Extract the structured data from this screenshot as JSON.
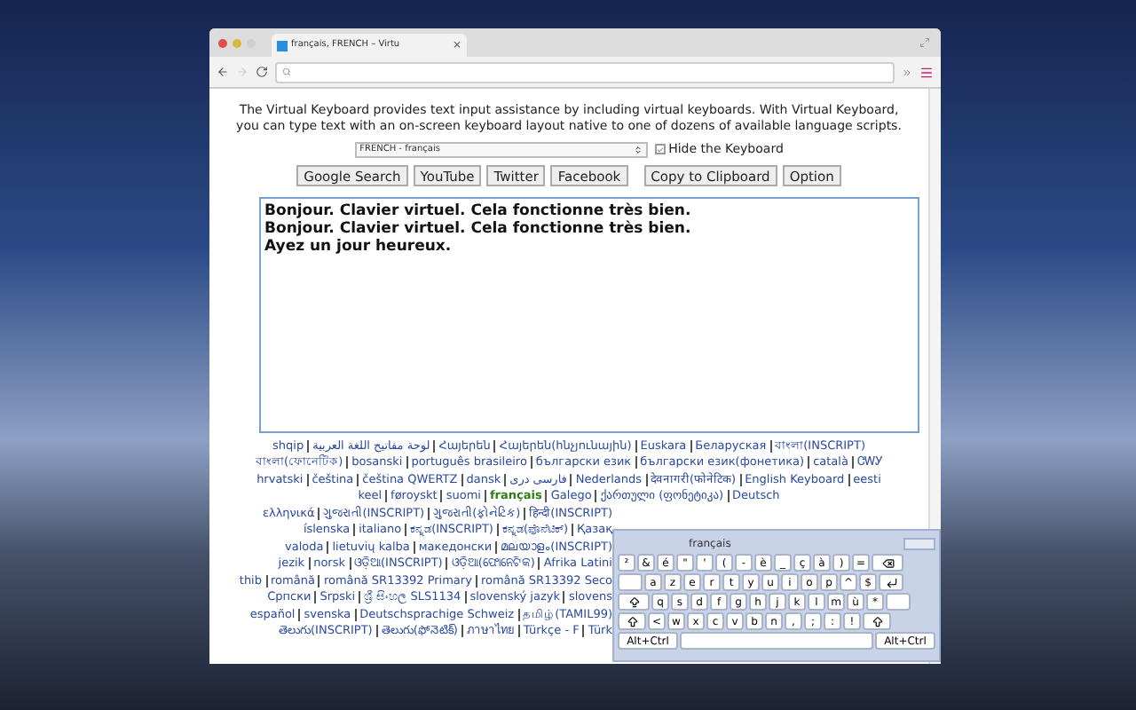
{
  "browser": {
    "tab": {
      "title": "français, FRENCH – Virtu",
      "close": "×"
    }
  },
  "intro": "The Virtual Keyboard provides text input assistance by including virtual keyboards. With Virtual Keyboard, you can type text with an on-screen keyboard layout native to one of dozens of available language scripts.",
  "language_select": {
    "value": "FRENCH - français"
  },
  "hide_keyboard": {
    "label": "Hide the Keyboard",
    "checked": true
  },
  "buttons": [
    "Google Search",
    "YouTube",
    "Twitter",
    "Facebook",
    "Copy to Clipboard",
    "Option"
  ],
  "editor": {
    "value": "Bonjour. Clavier virtuel. Cela fonctionne très bien.\nBonjour. Clavier virtuel. Cela fonctionne très bien.\nAyez un jour heureux."
  },
  "language_lines": [
    {
      "kind": "full",
      "items": [
        {
          "label": "shqip",
          "selected": false
        },
        {
          "label": "لوحة مفاتيح اللغة العربية",
          "selected": false
        },
        {
          "label": "Հայերեն",
          "selected": false
        },
        {
          "label": "Հայերեն(հնչյունային)",
          "selected": false
        },
        {
          "label": "Euskara",
          "selected": false
        },
        {
          "label": "Беларуская",
          "selected": false
        },
        {
          "label": "বাংলা(INSCRIPT)",
          "selected": false
        }
      ]
    },
    {
      "kind": "full",
      "items": [
        {
          "label": "বাংলা(ফোনেটিক)",
          "selected": false
        },
        {
          "label": "bosanski",
          "selected": false
        },
        {
          "label": "português brasileiro",
          "selected": false
        },
        {
          "label": "български език",
          "selected": false
        },
        {
          "label": "български език(фонетика)",
          "selected": false
        },
        {
          "label": "català",
          "selected": false
        },
        {
          "label": "ᏣᎳᎩ",
          "selected": false
        }
      ]
    },
    {
      "kind": "full",
      "items": [
        {
          "label": "hrvatski",
          "selected": false
        },
        {
          "label": "čeština",
          "selected": false
        },
        {
          "label": "čeština QWERTZ",
          "selected": false
        },
        {
          "label": "dansk",
          "selected": false
        },
        {
          "label": "فارسی دری",
          "selected": false
        },
        {
          "label": "Nederlands",
          "selected": false
        },
        {
          "label": "देवनागरी(फोनेटिक)",
          "selected": false
        },
        {
          "label": "English Keyboard",
          "selected": false
        },
        {
          "label": "eesti",
          "selected": false
        }
      ]
    },
    {
      "kind": "full",
      "items": [
        {
          "label": "keel",
          "selected": false
        },
        {
          "label": "føroyskt",
          "selected": false
        },
        {
          "label": "suomi",
          "selected": false
        },
        {
          "label": "français",
          "selected": true
        },
        {
          "label": "Galego",
          "selected": false
        },
        {
          "label": "ქართული (ფონეტიკა)",
          "selected": false
        },
        {
          "label": "Deutsch",
          "selected": false
        }
      ]
    },
    {
      "kind": "partial",
      "items": [
        {
          "label": "ελληνικά",
          "selected": false
        },
        {
          "label": "ગુજરાતી(INSCRIPT)",
          "selected": false
        },
        {
          "label": "ગુજરાતી(ફોનેટિક)",
          "selected": false
        },
        {
          "label": "हिन्दी(INSCRIPT)",
          "selected": false
        }
      ]
    },
    {
      "kind": "partial",
      "items": [
        {
          "label": "íslenska",
          "selected": false
        },
        {
          "label": "italiano",
          "selected": false
        },
        {
          "label": "ಕನ್ನಡ(INSCRIPT)",
          "selected": false
        },
        {
          "label": "ಕನ್ನಡ(ಫೊನೆಟಿಕ್)",
          "selected": false
        },
        {
          "label": "Қазақ",
          "selected": false
        }
      ]
    },
    {
      "kind": "partial",
      "items": [
        {
          "label": "valoda",
          "selected": false
        },
        {
          "label": "lietuvių kalba",
          "selected": false
        },
        {
          "label": "македонски",
          "selected": false
        },
        {
          "label": "മലയാളം(INSCRIPT)",
          "selected": false
        }
      ]
    },
    {
      "kind": "partial",
      "items": [
        {
          "label": "jezik",
          "selected": false
        },
        {
          "label": "norsk",
          "selected": false
        },
        {
          "label": "ଓଡ଼ିଆ(INSCRIPT)",
          "selected": false
        },
        {
          "label": "ଓଡ଼ିଆ(ଫୋନେଟିକ)",
          "selected": false
        },
        {
          "label": "Afrika Latini",
          "selected": false
        }
      ]
    },
    {
      "kind": "partial",
      "items": [
        {
          "label": "thib",
          "selected": false
        },
        {
          "label": "română",
          "selected": false
        },
        {
          "label": "română SR13392 Primary",
          "selected": false
        },
        {
          "label": "română SR13392 Seco",
          "selected": false
        }
      ]
    },
    {
      "kind": "partial",
      "items": [
        {
          "label": "Српски",
          "selected": false
        },
        {
          "label": "Srpski",
          "selected": false
        },
        {
          "label": "ශ්‍රී සිංහල SLS1134",
          "selected": false
        },
        {
          "label": "slovenský jazyk",
          "selected": false
        },
        {
          "label": "slovens",
          "selected": false
        }
      ]
    },
    {
      "kind": "partial",
      "items": [
        {
          "label": "español",
          "selected": false
        },
        {
          "label": "svenska",
          "selected": false
        },
        {
          "label": "Deutschsprachige Schweiz",
          "selected": false
        },
        {
          "label": "தமிழ்(TAMIL99)",
          "selected": false
        }
      ]
    },
    {
      "kind": "partial",
      "items": [
        {
          "label": "తెలుగు(INSCRIPT)",
          "selected": false
        },
        {
          "label": "తెలుగు(ఫోనెటిక్)",
          "selected": false
        },
        {
          "label": "ภาษาไทย",
          "selected": false
        },
        {
          "label": "Türkçe - F",
          "selected": false
        },
        {
          "label": "Türk",
          "selected": false
        }
      ]
    }
  ],
  "keyboard": {
    "title": "français",
    "rows": [
      {
        "keys": [
          {
            "kind": "key",
            "label": "²"
          },
          {
            "kind": "key",
            "label": "&"
          },
          {
            "kind": "key",
            "label": "é"
          },
          {
            "kind": "key",
            "label": "\""
          },
          {
            "kind": "key",
            "label": "'"
          },
          {
            "kind": "key",
            "label": "("
          },
          {
            "kind": "key",
            "label": "-"
          },
          {
            "kind": "key",
            "label": "è"
          },
          {
            "kind": "key",
            "label": "_"
          },
          {
            "kind": "key",
            "label": "ç"
          },
          {
            "kind": "key",
            "label": "à"
          },
          {
            "kind": "key",
            "label": ")"
          },
          {
            "kind": "key",
            "label": "="
          },
          {
            "kind": "backspace"
          }
        ]
      },
      {
        "keys": [
          {
            "kind": "tab"
          },
          {
            "kind": "key",
            "label": "a"
          },
          {
            "kind": "key",
            "label": "z"
          },
          {
            "kind": "key",
            "label": "e"
          },
          {
            "kind": "key",
            "label": "r"
          },
          {
            "kind": "key",
            "label": "t"
          },
          {
            "kind": "key",
            "label": "y"
          },
          {
            "kind": "key",
            "label": "u"
          },
          {
            "kind": "key",
            "label": "i"
          },
          {
            "kind": "key",
            "label": "o"
          },
          {
            "kind": "key",
            "label": "p"
          },
          {
            "kind": "key",
            "label": "^"
          },
          {
            "kind": "key",
            "label": "$"
          },
          {
            "kind": "enter"
          }
        ]
      },
      {
        "keys": [
          {
            "kind": "caps"
          },
          {
            "kind": "key",
            "label": "q"
          },
          {
            "kind": "key",
            "label": "s"
          },
          {
            "kind": "key",
            "label": "d"
          },
          {
            "kind": "key",
            "label": "f"
          },
          {
            "kind": "key",
            "label": "g"
          },
          {
            "kind": "key",
            "label": "h"
          },
          {
            "kind": "key",
            "label": "j"
          },
          {
            "kind": "key",
            "label": "k"
          },
          {
            "kind": "key",
            "label": "l"
          },
          {
            "kind": "key",
            "label": "m"
          },
          {
            "kind": "key",
            "label": "ù"
          },
          {
            "kind": "key",
            "label": "*"
          },
          {
            "kind": "tab"
          }
        ]
      },
      {
        "keys": [
          {
            "kind": "shift"
          },
          {
            "kind": "key",
            "label": "<"
          },
          {
            "kind": "key",
            "label": "w"
          },
          {
            "kind": "key",
            "label": "x"
          },
          {
            "kind": "key",
            "label": "c"
          },
          {
            "kind": "key",
            "label": "v"
          },
          {
            "kind": "key",
            "label": "b"
          },
          {
            "kind": "key",
            "label": "n"
          },
          {
            "kind": "key",
            "label": ","
          },
          {
            "kind": "key",
            "label": ";"
          },
          {
            "kind": "key",
            "label": ":"
          },
          {
            "kind": "key",
            "label": "!"
          },
          {
            "kind": "shift"
          }
        ]
      },
      {
        "keys": [
          {
            "kind": "wide",
            "label": "Alt+Ctrl"
          },
          {
            "kind": "space"
          },
          {
            "kind": "wide",
            "label": "Alt+Ctrl"
          }
        ]
      }
    ]
  }
}
